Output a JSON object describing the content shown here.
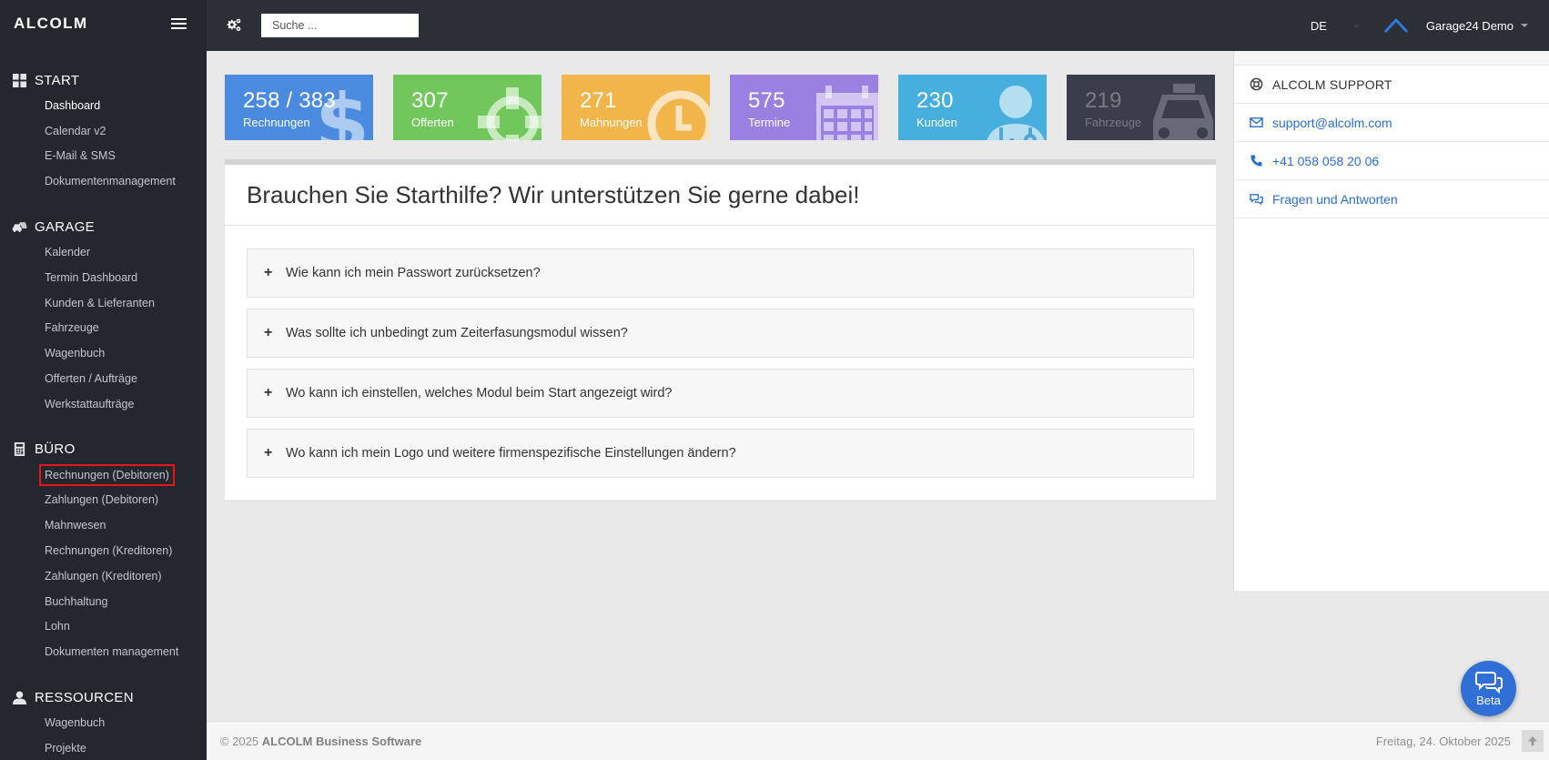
{
  "brand": "ALCOLM",
  "search": {
    "placeholder": "Suche ..."
  },
  "topbar": {
    "lang": "DE",
    "user": "Garage24 Demo"
  },
  "sidebar": {
    "sections": [
      {
        "title": "START",
        "icon": "dashboard-grid-icon",
        "items": [
          "Dashboard",
          "Calendar v2",
          "E-Mail & SMS",
          "Dokumentenmanagement"
        ]
      },
      {
        "title": "GARAGE",
        "icon": "cars-icon",
        "items": [
          "Kalender",
          "Termin Dashboard",
          "Kunden & Lieferanten",
          "Fahrzeuge",
          "Wagenbuch",
          "Offerten / Aufträge",
          "Werkstattaufträge"
        ]
      },
      {
        "title": "BÜRO",
        "icon": "calculator-icon",
        "items": [
          "Rechnungen (Debitoren)",
          "Zahlungen (Debitoren)",
          "Mahnwesen",
          "Rechnungen (Kreditoren)",
          "Zahlungen (Kreditoren)",
          "Buchhaltung",
          "Lohn",
          "Dokumenten management"
        ]
      },
      {
        "title": "RESSOURCEN",
        "icon": "user-icon",
        "items": [
          "Wagenbuch",
          "Projekte"
        ]
      }
    ]
  },
  "stats": [
    {
      "num": "258 / 383",
      "label": "Rechnungen",
      "color": "#4a8be0",
      "icon": "dollar-icon"
    },
    {
      "num": "307",
      "label": "Offerten",
      "color": "#72c75c",
      "icon": "crosshair-icon"
    },
    {
      "num": "271",
      "label": "Mahnungen",
      "color": "#f1b54a",
      "icon": "clock-icon"
    },
    {
      "num": "575",
      "label": "Termine",
      "color": "#9a80e0",
      "icon": "calendar-icon"
    },
    {
      "num": "230",
      "label": "Kunden",
      "color": "#47afdd",
      "icon": "doctor-icon"
    },
    {
      "num": "219",
      "label": "Fahrzeuge",
      "color": "#3a3d4a",
      "icon": "taxi-icon"
    }
  ],
  "help": {
    "title": "Brauchen Sie Starthilfe? Wir unterstützen Sie gerne dabei!",
    "faqs": [
      "Wie kann ich mein Passwort zurücksetzen?",
      "Was sollte ich unbedingt zum Zeiterfasungsmodul wissen?",
      "Wo kann ich einstellen, welches Modul beim Start angezeigt wird?",
      "Wo kann ich mein Logo und weitere firmenspezifische Einstellungen ändern?"
    ]
  },
  "support": {
    "title": "ALCOLM SUPPORT",
    "email": "support@alcolm.com",
    "phone": "+41 058 058 20 06",
    "faq": "Fragen und Antworten"
  },
  "footer": {
    "copyright": "© 2025 ",
    "company": "ALCOLM Business Software",
    "date": "Freitag, 24. Oktober 2025"
  },
  "beta": "Beta"
}
